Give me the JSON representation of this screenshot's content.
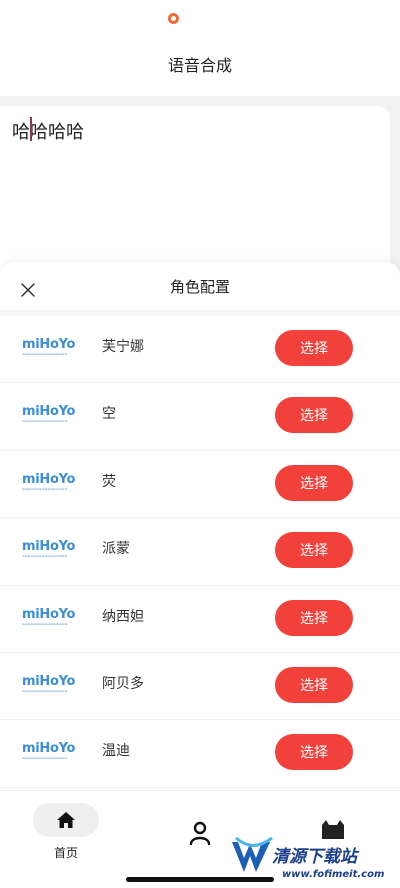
{
  "header": {
    "title": "语音合成"
  },
  "editor": {
    "text": "哈哈哈哈"
  },
  "sheet": {
    "title": "角色配置",
    "items": [
      {
        "logo": "miHoYo",
        "name": "芙宁娜",
        "button": "选择"
      },
      {
        "logo": "miHoYo",
        "name": "空",
        "button": "选择"
      },
      {
        "logo": "miHoYo",
        "name": "荧",
        "button": "选择"
      },
      {
        "logo": "miHoYo",
        "name": "派蒙",
        "button": "选择"
      },
      {
        "logo": "miHoYo",
        "name": "纳西妲",
        "button": "选择"
      },
      {
        "logo": "miHoYo",
        "name": "阿贝多",
        "button": "选择"
      },
      {
        "logo": "miHoYo",
        "name": "温迪",
        "button": "选择"
      }
    ]
  },
  "tabbar": {
    "home_label": "首页",
    "icons": [
      "home-icon",
      "person-icon",
      "cat-icon"
    ]
  },
  "watermark": {
    "text": "清源下载站",
    "url": "www.fofimeit.com"
  },
  "colors": {
    "accent": "#f2403a",
    "status_dot": "#f06a35",
    "logo_blue": "#3b8fd6"
  }
}
